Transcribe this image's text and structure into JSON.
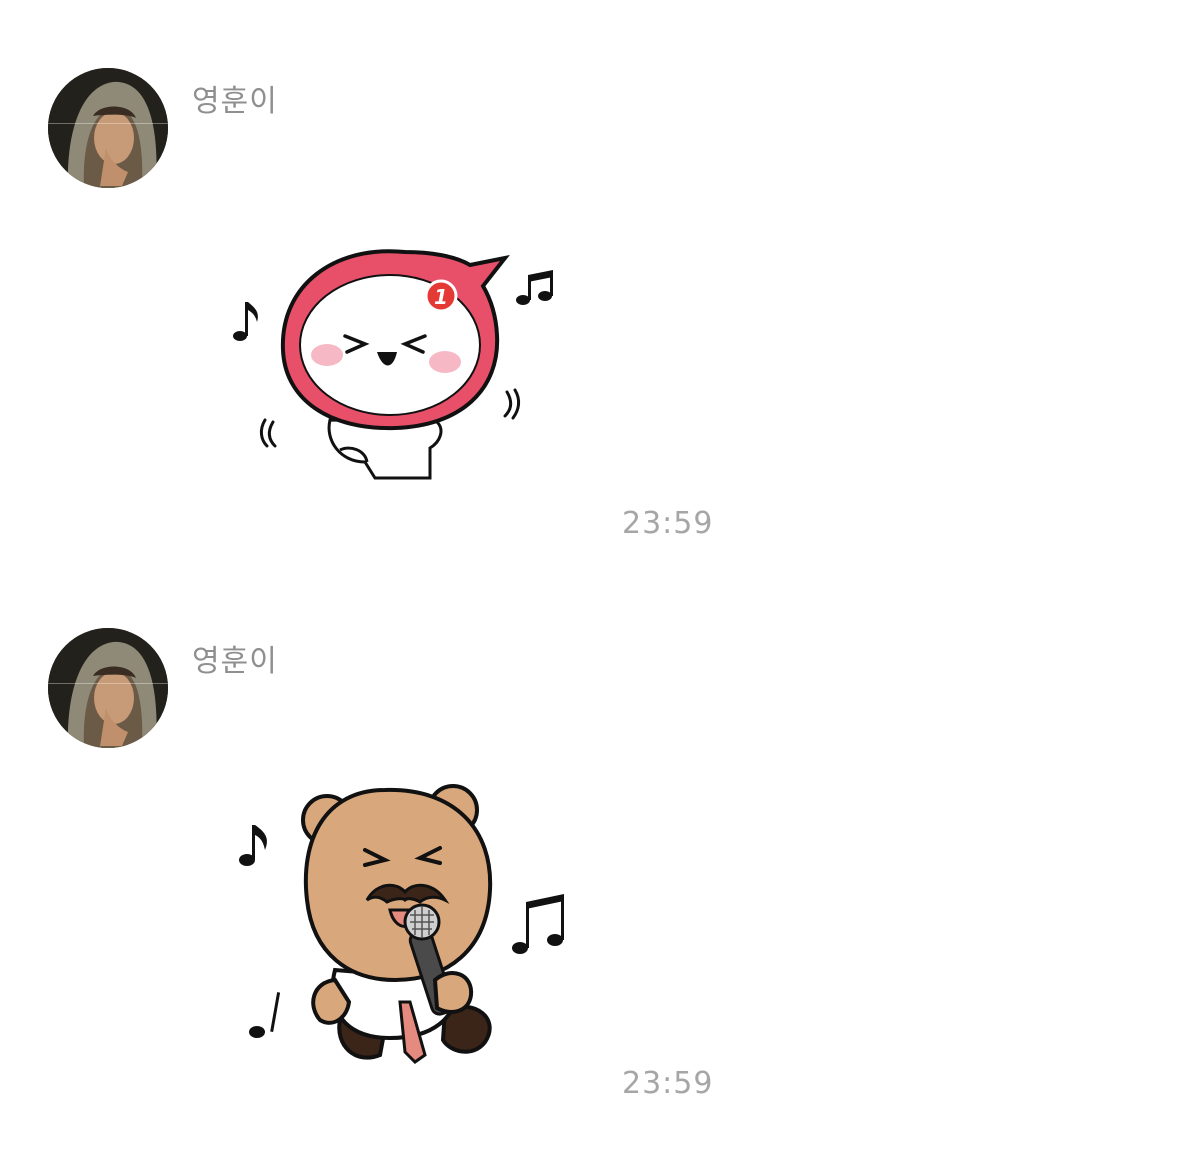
{
  "messages": [
    {
      "sender_name": "영훈이",
      "avatar_icon": "profile-photo-avatar",
      "sticker_icon": "pink-speech-bubble-dancing-sticker",
      "sticker_badge": "1",
      "time": "23:59"
    },
    {
      "sender_name": "영훈이",
      "avatar_icon": "profile-photo-avatar",
      "sticker_icon": "mustache-bear-singing-microphone-sticker",
      "time": "23:59"
    }
  ],
  "colors": {
    "background": "#ffffff",
    "name_text": "#8f8f8f",
    "time_text": "#a6a6a6",
    "sticker_pink": "#e8506a",
    "sticker_badge_red": "#e53935",
    "bear_brown": "#d9a77c"
  }
}
